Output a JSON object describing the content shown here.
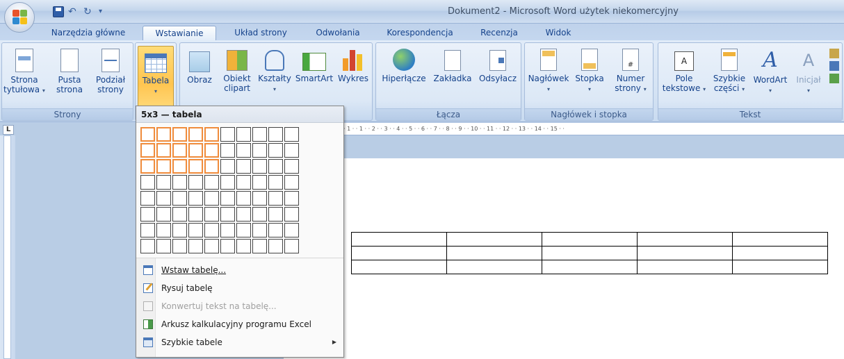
{
  "window": {
    "title": "Dokument2 - Microsoft Word użytek niekomercyjny"
  },
  "tabs": [
    {
      "label": "Narzędzia główne"
    },
    {
      "label": "Wstawianie",
      "active": true
    },
    {
      "label": "Układ strony"
    },
    {
      "label": "Odwołania"
    },
    {
      "label": "Korespondencja"
    },
    {
      "label": "Recenzja"
    },
    {
      "label": "Widok"
    }
  ],
  "ribbon": {
    "strony": {
      "label": "Strony",
      "strona_tytulowa": [
        "Strona",
        "tytułowa"
      ],
      "pusta_strona": [
        "Pusta",
        "strona"
      ],
      "podzial_strony": [
        "Podział",
        "strony"
      ]
    },
    "tabele": {
      "tabela": "Tabela"
    },
    "ilustracje": {
      "obraz": "Obraz",
      "obiekt_clipart": [
        "Obiekt",
        "clipart"
      ],
      "ksztalty": "Kształty",
      "smartart": "SmartArt",
      "wykres": "Wykres"
    },
    "lacza": {
      "label": "Łącza",
      "hiperlacze": "Hiperłącze",
      "zakladka": "Zakładka",
      "odsylacz": "Odsyłacz"
    },
    "naglowek_stopka": {
      "label": "Nagłówek i stopka",
      "naglowek": "Nagłówek",
      "stopka": "Stopka",
      "numer_strony": [
        "Numer",
        "strony"
      ]
    },
    "tekst": {
      "label": "Tekst",
      "pole_tekstowe": [
        "Pole",
        "tekstowe"
      ],
      "szybkie_czesci": [
        "Szybkie",
        "części"
      ],
      "wordart": "WordArt",
      "inicjal": "Inicjał"
    }
  },
  "table_menu": {
    "header": "5x3 — tabela",
    "grid_cols": 10,
    "grid_rows": 8,
    "selected_cols": 5,
    "selected_rows": 3,
    "items": [
      {
        "label": "Wstaw tabelę...",
        "enabled": true
      },
      {
        "label": "Rysuj tabelę",
        "enabled": true
      },
      {
        "label": "Konwertuj tekst na tabelę...",
        "enabled": false
      },
      {
        "label": "Arkusz kalkulacyjny programu Excel",
        "enabled": true
      },
      {
        "label": "Szybkie tabele",
        "enabled": true,
        "submenu": true
      }
    ]
  },
  "ruler": {
    "corner": "L",
    "marks": "· 1 · · 1 · · 2 · · 3 · · 4 · · 5 · · 6 · · 7 · · 8 · · 9 · · 10 · · 11 · · 12 · · 13 · · 14 · · 15 · ·"
  },
  "document_table": {
    "rows": 3,
    "cols": 5
  },
  "colors": {
    "accent": "#f08c3c",
    "ribbon": "#dce8f6",
    "text": "#15428b"
  }
}
